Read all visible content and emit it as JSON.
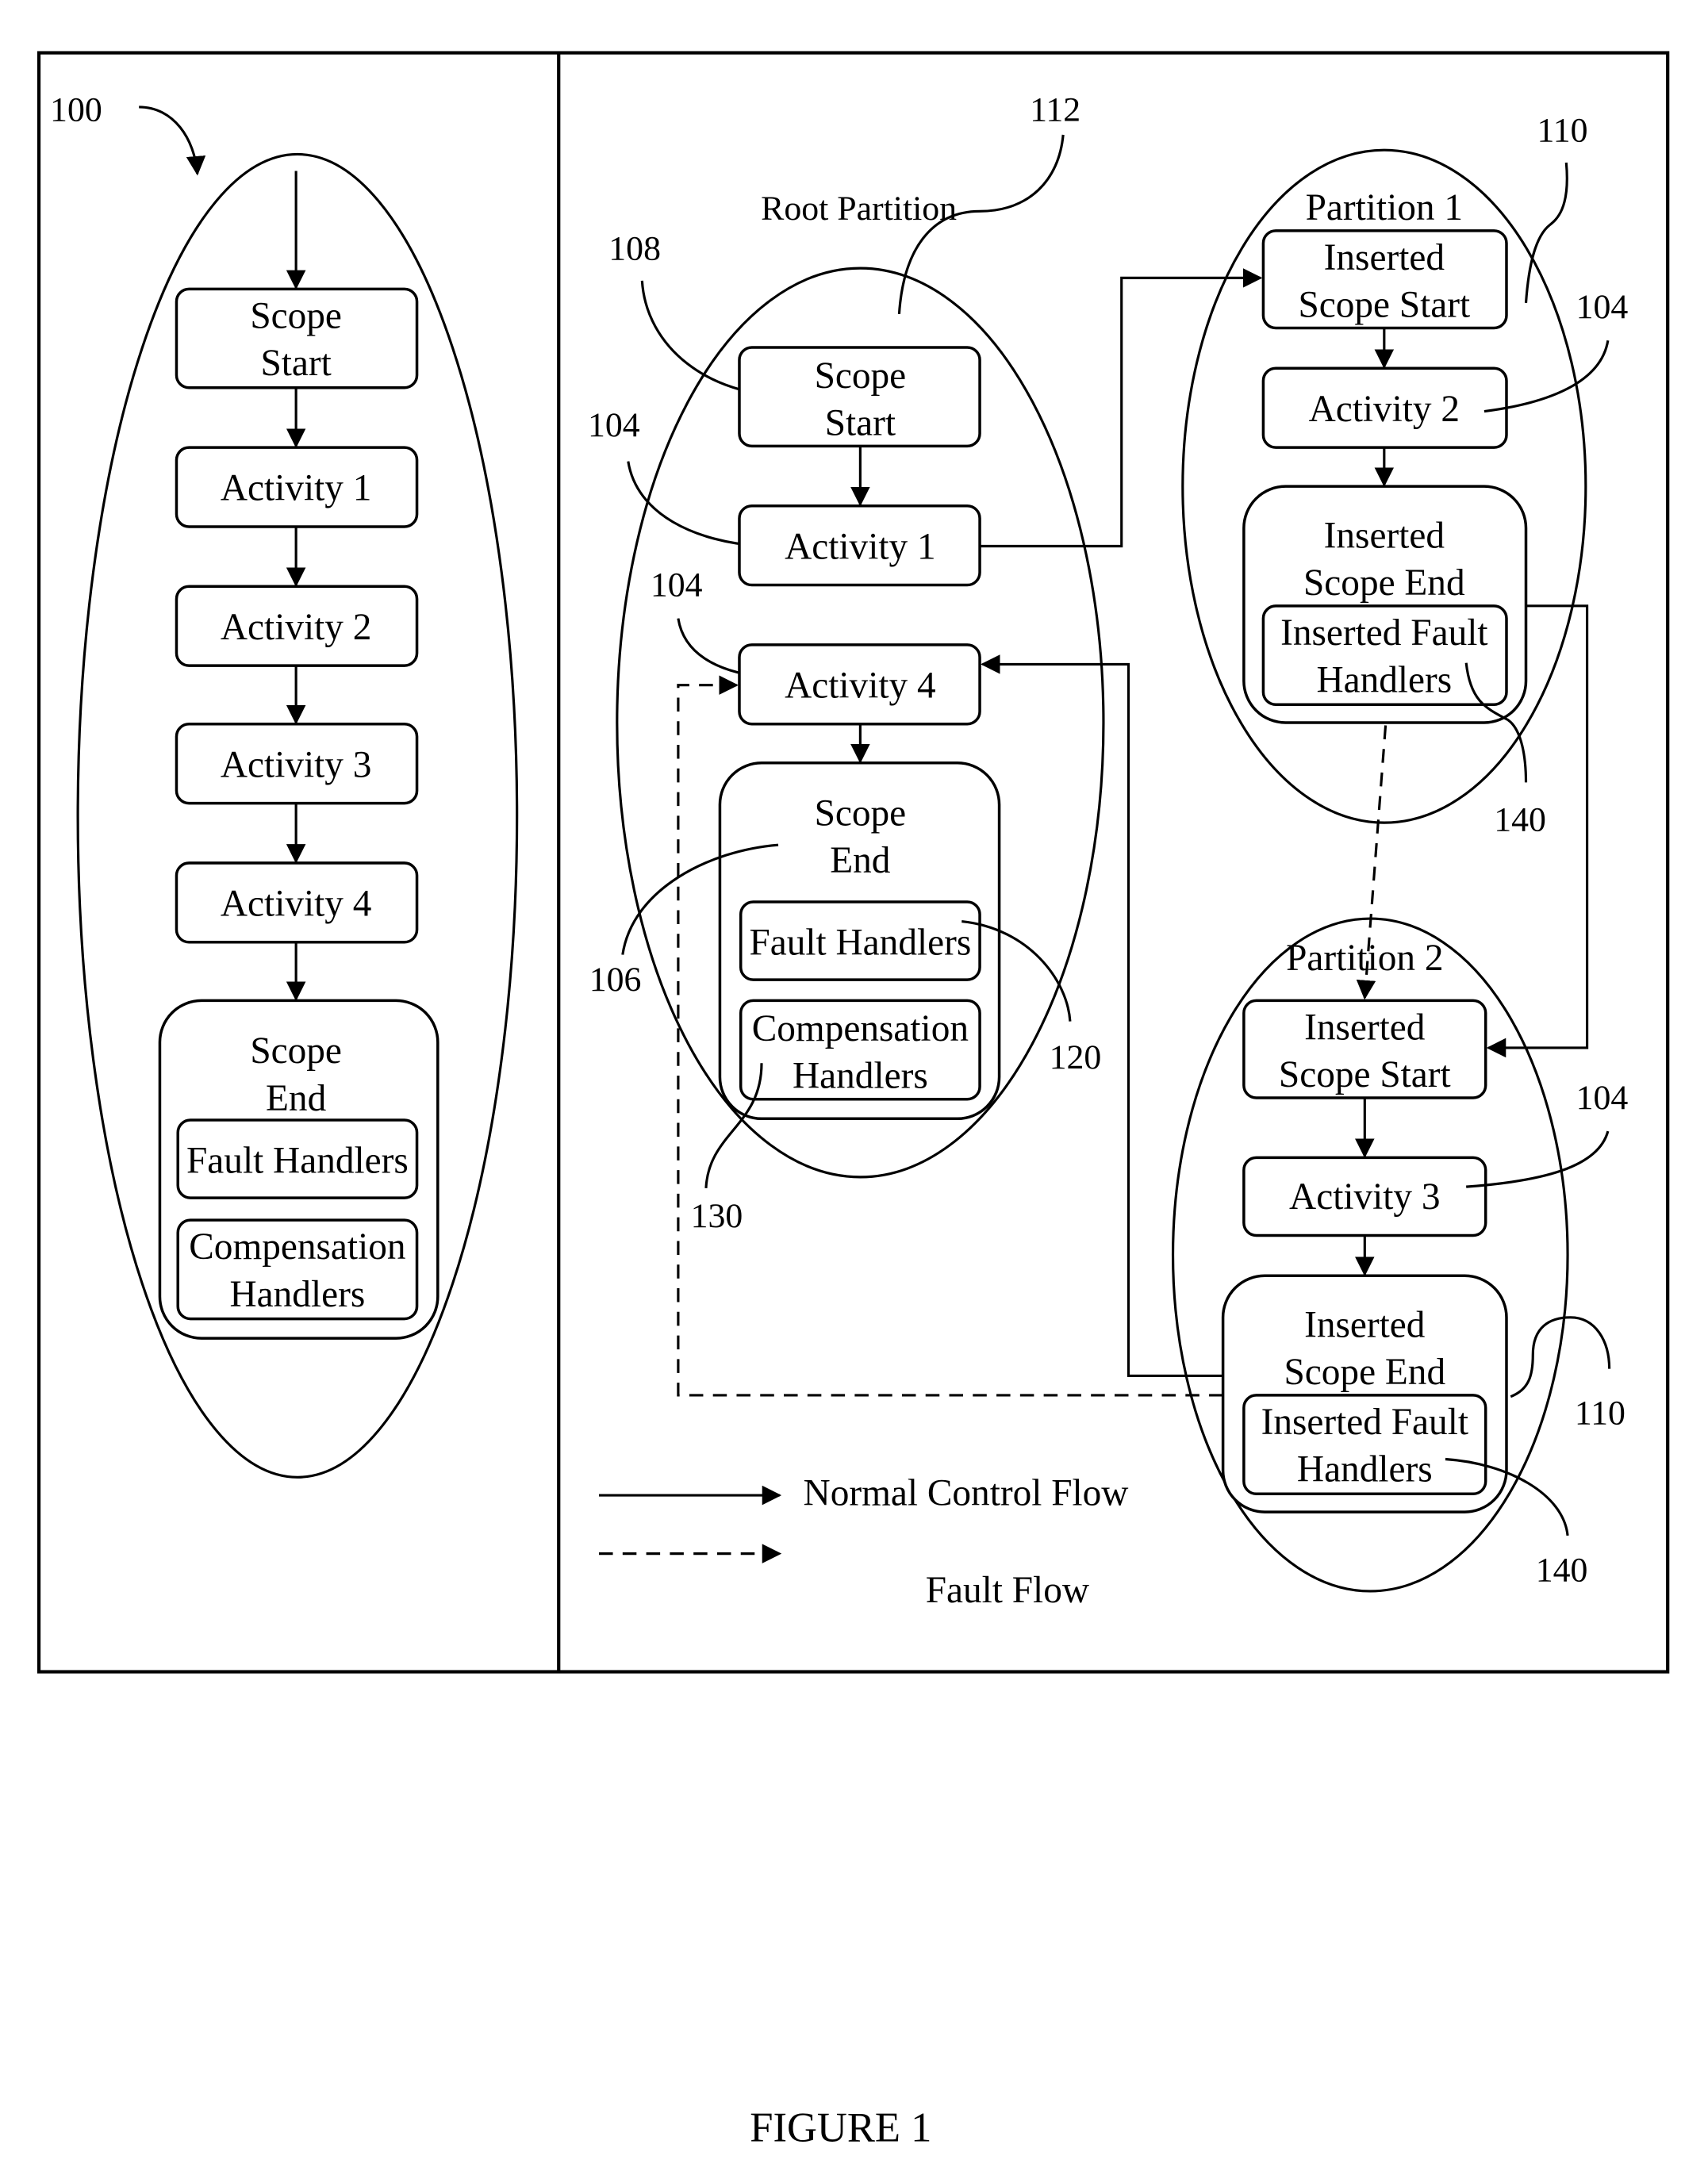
{
  "figure": {
    "caption": "FIGURE 1",
    "colors": {
      "ink": "#000000",
      "background": "#ffffff"
    }
  },
  "left_panel": {
    "ref": "100",
    "nodes": {
      "scope_start": [
        "Scope",
        "Start"
      ],
      "activity1": "Activity 1",
      "activity2": "Activity 2",
      "activity3": "Activity 3",
      "activity4": "Activity 4",
      "scope_end": [
        "Scope",
        "End"
      ],
      "fault_handlers": "Fault Handlers",
      "compensation_handlers": [
        "Compensation",
        "Handlers"
      ]
    }
  },
  "root_partition": {
    "title": "Root Partition",
    "ref": "112",
    "nodes": {
      "scope_start": [
        "Scope",
        "Start"
      ],
      "activity1": "Activity 1",
      "activity4": "Activity 4",
      "scope_end": [
        "Scope",
        "End"
      ],
      "fault_handlers": "Fault Handlers",
      "compensation_handlers": [
        "Compensation",
        "Handlers"
      ]
    },
    "refs": {
      "scope_start": "108",
      "activity1": "104",
      "activity4": "104",
      "scope_end": "106",
      "fault_handlers": "120",
      "compensation_handlers": "130"
    }
  },
  "partition1": {
    "title": "Partition 1",
    "ref": "110",
    "nodes": {
      "inserted_scope_start": [
        "Inserted",
        "Scope Start"
      ],
      "activity2": "Activity 2",
      "inserted_scope_end": [
        "Inserted",
        "Scope End"
      ],
      "inserted_fault_handlers": [
        "Inserted Fault",
        "Handlers"
      ]
    },
    "refs": {
      "activity2": "104",
      "inserted_fault_handlers": "140"
    }
  },
  "partition2": {
    "title": "Partition 2",
    "ref": "110",
    "nodes": {
      "inserted_scope_start": [
        "Inserted",
        "Scope Start"
      ],
      "activity3": "Activity 3",
      "inserted_scope_end": [
        "Inserted",
        "Scope End"
      ],
      "inserted_fault_handlers": [
        "Inserted Fault",
        "Handlers"
      ]
    },
    "refs": {
      "activity3": "104",
      "inserted_fault_handlers": "140"
    }
  },
  "legend": {
    "normal": "Normal Control Flow",
    "fault": "Fault Flow"
  }
}
